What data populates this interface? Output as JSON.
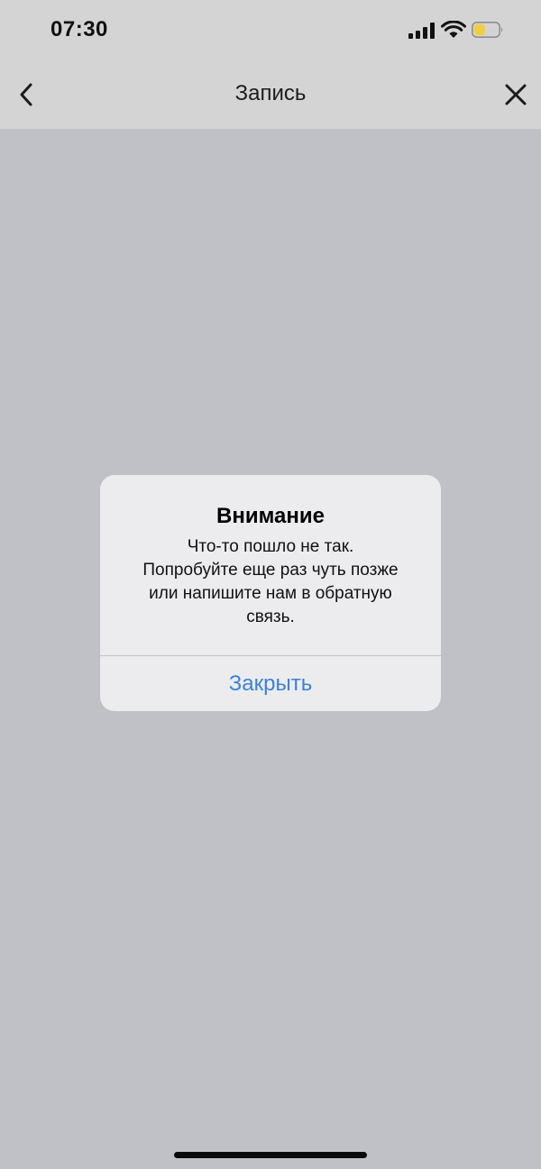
{
  "status_bar": {
    "time": "07:30",
    "signal_icon": "cellular-signal-icon",
    "wifi_icon": "wifi-icon",
    "battery_icon": "battery-icon",
    "battery_level": 0.45,
    "battery_color": "#f2ce3d"
  },
  "nav_bar": {
    "title": "Запись",
    "back_icon": "chevron-left-icon",
    "close_icon": "close-icon"
  },
  "alert": {
    "title": "Внимание",
    "message": "Что-то пошло не так.\nПопробуйте еще раз чуть позже\nили напишите нам в обратную\nсвязь.",
    "button_label": "Закрыть",
    "button_color": "#3a82e0"
  }
}
